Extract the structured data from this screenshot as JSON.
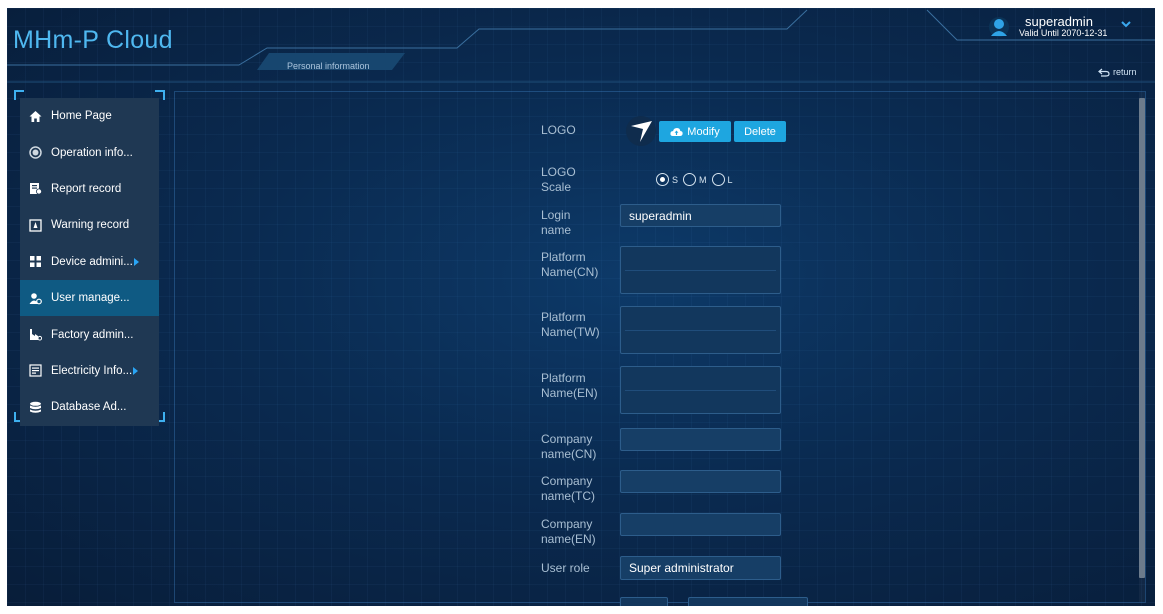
{
  "app": {
    "title": "MHm-P Cloud"
  },
  "header": {
    "tab_label": "Personal information",
    "user": {
      "name": "superadmin",
      "valid_until": "Valid Until 2070-12-31"
    },
    "return_label": "return"
  },
  "sidebar": {
    "items": [
      {
        "label": "Home Page",
        "icon": "home-icon",
        "active": false,
        "has_submenu": false
      },
      {
        "label": "Operation info...",
        "icon": "operation-icon",
        "active": false,
        "has_submenu": false
      },
      {
        "label": "Report record",
        "icon": "report-icon",
        "active": false,
        "has_submenu": false
      },
      {
        "label": "Warning record",
        "icon": "warning-icon",
        "active": false,
        "has_submenu": false
      },
      {
        "label": "Device admini...",
        "icon": "device-icon",
        "active": false,
        "has_submenu": true
      },
      {
        "label": "User manage...",
        "icon": "user-icon",
        "active": true,
        "has_submenu": false
      },
      {
        "label": "Factory admin...",
        "icon": "factory-icon",
        "active": false,
        "has_submenu": false
      },
      {
        "label": "Electricity Info...",
        "icon": "electricity-icon",
        "active": false,
        "has_submenu": true
      },
      {
        "label": "Database Ad...",
        "icon": "database-icon",
        "active": false,
        "has_submenu": false
      }
    ]
  },
  "form": {
    "logo": {
      "label": "LOGO",
      "modify_label": "Modify",
      "delete_label": "Delete"
    },
    "logo_scale": {
      "label": "LOGO Scale",
      "options": [
        "S",
        "M",
        "L"
      ],
      "selected": "S"
    },
    "login_name": {
      "label": "Login name",
      "value": "superadmin"
    },
    "platform_name_cn": {
      "label": "Platform Name(CN)",
      "value": ""
    },
    "platform_name_tw": {
      "label": "Platform Name(TW)",
      "value": ""
    },
    "platform_name_en": {
      "label": "Platform Name(EN)",
      "value": ""
    },
    "company_name_cn": {
      "label": "Company name(CN)",
      "value": ""
    },
    "company_name_tc": {
      "label": "Company name(TC)",
      "value": ""
    },
    "company_name_en": {
      "label": "Company name(EN)",
      "value": ""
    },
    "user_role": {
      "label": "User role",
      "value": "Super administrator"
    }
  },
  "colors": {
    "accent": "#1ea6e0",
    "title": "#4fb8f0",
    "sidebar_bg": "#1f3853",
    "sidebar_active": "#0f5a83",
    "background": "#0a2a50"
  }
}
